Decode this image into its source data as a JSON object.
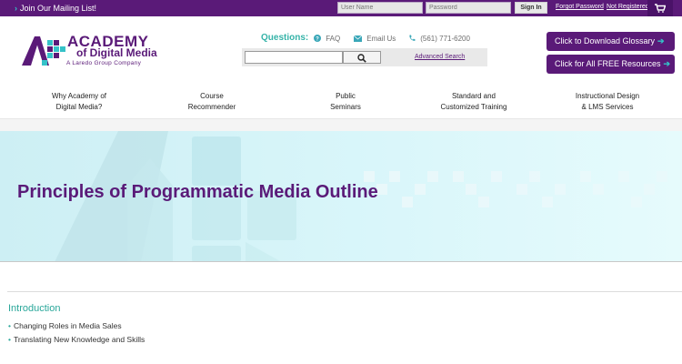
{
  "topbar": {
    "mailing_chevron": "›",
    "mailing_label": "Join Our Mailing List!",
    "username_placeholder": "User Name",
    "password_placeholder": "Password",
    "signin_label": "Sign In",
    "forgot_label": "Forgot Password",
    "register_label": "Not Registered?"
  },
  "logo": {
    "line1": "ACADEMY",
    "line2": "of Digital Media",
    "line3": "A Laredo Group Company"
  },
  "contact": {
    "questions_label": "Questions:",
    "faq_label": "FAQ",
    "email_label": "Email Us",
    "phone_label": "(561) 771-6200"
  },
  "search": {
    "placeholder": "",
    "advanced_label": "Advanced Search"
  },
  "cta": {
    "glossary_label": "Click to Download Glossary",
    "resources_label": "Click for All FREE Resources",
    "arrow": "➔"
  },
  "nav": {
    "items": [
      {
        "line1": "Why Academy of",
        "line2": "Digital Media?"
      },
      {
        "line1": "Course",
        "line2": "Recommender"
      },
      {
        "line1": "Public",
        "line2": "Seminars"
      },
      {
        "line1": "Standard and",
        "line2": "Customized Training"
      },
      {
        "line1": "Instructional Design",
        "line2": "& LMS Services"
      }
    ]
  },
  "hero": {
    "title": "Principles of Programmatic Media Outline"
  },
  "content": {
    "section_heading": "Introduction",
    "bullet_glyph": "•",
    "bullets": [
      "Changing Roles in Media Sales",
      "Translating New Knowledge and Skills"
    ]
  },
  "colors": {
    "brand_purple": "#5a1a78",
    "accent_teal": "#35c2c8",
    "heading_teal": "#2aa79a"
  }
}
